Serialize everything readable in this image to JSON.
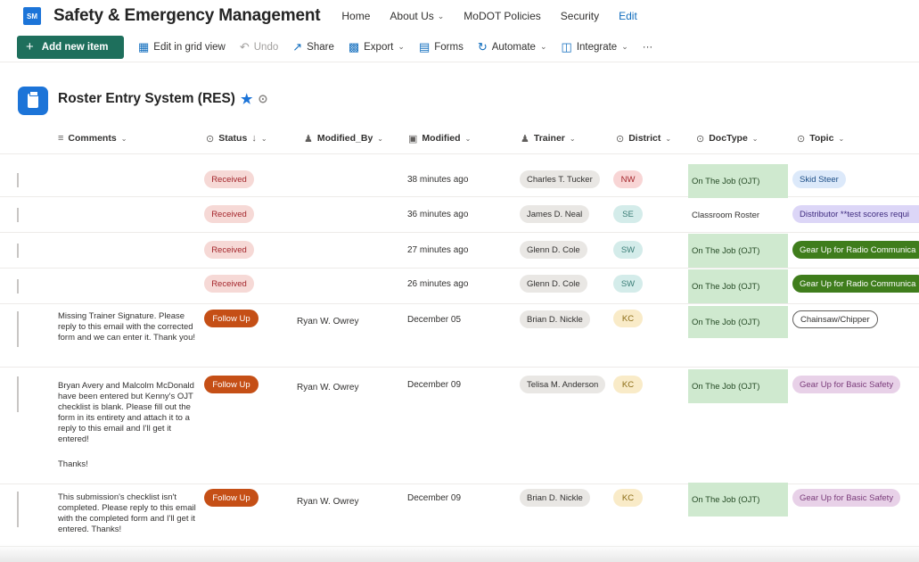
{
  "site": {
    "logo_text": "SM",
    "title": "Safety & Emergency Management"
  },
  "nav": [
    {
      "label": "Home",
      "has_menu": false
    },
    {
      "label": "About Us",
      "has_menu": true
    },
    {
      "label": "MoDOT Policies",
      "has_menu": false
    },
    {
      "label": "Security",
      "has_menu": false
    },
    {
      "label": "Edit",
      "has_menu": false
    }
  ],
  "commands": {
    "add": "Add new item",
    "grid": "Edit in grid view",
    "undo": "Undo",
    "share": "Share",
    "export": "Export",
    "forms": "Forms",
    "automate": "Automate",
    "integrate": "Integrate",
    "more": "···"
  },
  "list": {
    "title": "Roster Entry System (RES)"
  },
  "columns": {
    "comments": "Comments",
    "status": "Status",
    "modified_by": "Modified_By",
    "modified": "Modified",
    "trainer": "Trainer",
    "district": "District",
    "doctype": "DocType",
    "topic": "Topic"
  },
  "rows": [
    {
      "comment": "",
      "status": "Received",
      "modified_by": "",
      "modified": "38 minutes ago",
      "trainer": "Charles T. Tucker",
      "district": "NW",
      "doctype": "On The Job (OJT)",
      "topic": "Skid Steer"
    },
    {
      "comment": "",
      "status": "Received",
      "modified_by": "",
      "modified": "36 minutes ago",
      "trainer": "James D. Neal",
      "district": "SE",
      "doctype": "Classroom Roster",
      "topic": "Distributor **test scores requi"
    },
    {
      "comment": "",
      "status": "Received",
      "modified_by": "",
      "modified": "27 minutes ago",
      "trainer": "Glenn D. Cole",
      "district": "SW",
      "doctype": "On The Job (OJT)",
      "topic": "Gear Up for Radio Communica"
    },
    {
      "comment": "",
      "status": "Received",
      "modified_by": "",
      "modified": "26 minutes ago",
      "trainer": "Glenn D. Cole",
      "district": "SW",
      "doctype": "On The Job (OJT)",
      "topic": "Gear Up for Radio Communica"
    },
    {
      "comment": "Missing Trainer Signature. Please reply to this email with the corrected form and we can enter it. Thank you!",
      "status": "Follow Up",
      "modified_by": "Ryan W. Owrey",
      "modified": "December 05",
      "trainer": "Brian D. Nickle",
      "district": "KC",
      "doctype": "On The Job (OJT)",
      "topic": "Chainsaw/Chipper"
    },
    {
      "comment": "Bryan Avery and Malcolm McDonald have been entered but Kenny's OJT checklist is blank. Please fill out the form in its entirety and attach it to a reply to this email and I'll get it entered!",
      "comment2": "Thanks!",
      "status": "Follow Up",
      "modified_by": "Ryan W. Owrey",
      "modified": "December 09",
      "trainer": "Telisa M. Anderson",
      "district": "KC",
      "doctype": "On The Job (OJT)",
      "topic": "Gear Up for Basic Safety"
    },
    {
      "comment": "This submission's checklist isn't completed. Please reply to this email with the completed form and I'll get it entered. Thanks!",
      "status": "Follow Up",
      "modified_by": "Ryan W. Owrey",
      "modified": "December 09",
      "trainer": "Brian D. Nickle",
      "district": "KC",
      "doctype": "On The Job (OJT)",
      "topic": "Gear Up for Basic Safety"
    }
  ],
  "colors": {
    "accent": "#1c74d8",
    "add_button": "#1e6f5c",
    "follow_up": "#c54f16",
    "ojt": "#cfe9cf",
    "radio": "#3f7d1c"
  }
}
